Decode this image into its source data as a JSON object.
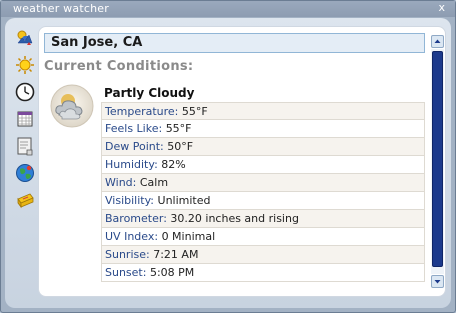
{
  "window": {
    "title": "weather watcher",
    "close_label": "x"
  },
  "sidebar": {
    "items": [
      {
        "icon": "current-conditions-icon"
      },
      {
        "icon": "sun-icon"
      },
      {
        "icon": "clock-icon"
      },
      {
        "icon": "calendar-icon"
      },
      {
        "icon": "notes-icon"
      },
      {
        "icon": "globe-icon"
      },
      {
        "icon": "toolbox-icon"
      }
    ]
  },
  "location": {
    "name": "San Jose, CA"
  },
  "section": {
    "heading": "Current Conditions:"
  },
  "conditions": {
    "icon": "partly-cloudy-icon",
    "summary": "Partly Cloudy",
    "rows": [
      {
        "label": "Temperature:",
        "value": "55°F"
      },
      {
        "label": "Feels Like:",
        "value": "55°F"
      },
      {
        "label": "Dew Point:",
        "value": "50°F"
      },
      {
        "label": "Humidity:",
        "value": "82%"
      },
      {
        "label": "Wind:",
        "value": " Calm"
      },
      {
        "label": "Visibility:",
        "value": "Unlimited"
      },
      {
        "label": "Barometer:",
        "value": "30.20 inches and rising"
      },
      {
        "label": "UV Index:",
        "value": "0 Minimal"
      },
      {
        "label": "Sunrise:",
        "value": "7:21 AM"
      },
      {
        "label": "Sunset:",
        "value": "5:08 PM"
      }
    ]
  },
  "colors": {
    "accent": "#1c3a8c",
    "label_text": "#2a4a8a",
    "location_bg": "#e4edf6"
  }
}
